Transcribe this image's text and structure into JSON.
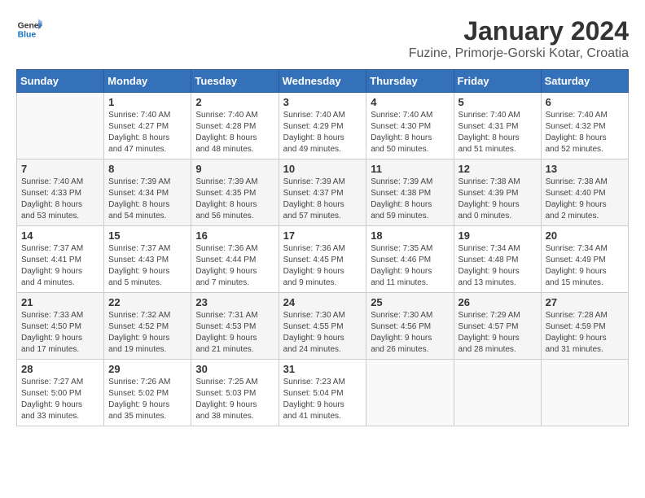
{
  "header": {
    "logo_general": "General",
    "logo_blue": "Blue",
    "title": "January 2024",
    "subtitle": "Fuzine, Primorje-Gorski Kotar, Croatia"
  },
  "calendar": {
    "days_of_week": [
      "Sunday",
      "Monday",
      "Tuesday",
      "Wednesday",
      "Thursday",
      "Friday",
      "Saturday"
    ],
    "weeks": [
      [
        {
          "day": "",
          "info": ""
        },
        {
          "day": "1",
          "info": "Sunrise: 7:40 AM\nSunset: 4:27 PM\nDaylight: 8 hours\nand 47 minutes."
        },
        {
          "day": "2",
          "info": "Sunrise: 7:40 AM\nSunset: 4:28 PM\nDaylight: 8 hours\nand 48 minutes."
        },
        {
          "day": "3",
          "info": "Sunrise: 7:40 AM\nSunset: 4:29 PM\nDaylight: 8 hours\nand 49 minutes."
        },
        {
          "day": "4",
          "info": "Sunrise: 7:40 AM\nSunset: 4:30 PM\nDaylight: 8 hours\nand 50 minutes."
        },
        {
          "day": "5",
          "info": "Sunrise: 7:40 AM\nSunset: 4:31 PM\nDaylight: 8 hours\nand 51 minutes."
        },
        {
          "day": "6",
          "info": "Sunrise: 7:40 AM\nSunset: 4:32 PM\nDaylight: 8 hours\nand 52 minutes."
        }
      ],
      [
        {
          "day": "7",
          "info": "Sunrise: 7:40 AM\nSunset: 4:33 PM\nDaylight: 8 hours\nand 53 minutes."
        },
        {
          "day": "8",
          "info": "Sunrise: 7:39 AM\nSunset: 4:34 PM\nDaylight: 8 hours\nand 54 minutes."
        },
        {
          "day": "9",
          "info": "Sunrise: 7:39 AM\nSunset: 4:35 PM\nDaylight: 8 hours\nand 56 minutes."
        },
        {
          "day": "10",
          "info": "Sunrise: 7:39 AM\nSunset: 4:37 PM\nDaylight: 8 hours\nand 57 minutes."
        },
        {
          "day": "11",
          "info": "Sunrise: 7:39 AM\nSunset: 4:38 PM\nDaylight: 8 hours\nand 59 minutes."
        },
        {
          "day": "12",
          "info": "Sunrise: 7:38 AM\nSunset: 4:39 PM\nDaylight: 9 hours\nand 0 minutes."
        },
        {
          "day": "13",
          "info": "Sunrise: 7:38 AM\nSunset: 4:40 PM\nDaylight: 9 hours\nand 2 minutes."
        }
      ],
      [
        {
          "day": "14",
          "info": "Sunrise: 7:37 AM\nSunset: 4:41 PM\nDaylight: 9 hours\nand 4 minutes."
        },
        {
          "day": "15",
          "info": "Sunrise: 7:37 AM\nSunset: 4:43 PM\nDaylight: 9 hours\nand 5 minutes."
        },
        {
          "day": "16",
          "info": "Sunrise: 7:36 AM\nSunset: 4:44 PM\nDaylight: 9 hours\nand 7 minutes."
        },
        {
          "day": "17",
          "info": "Sunrise: 7:36 AM\nSunset: 4:45 PM\nDaylight: 9 hours\nand 9 minutes."
        },
        {
          "day": "18",
          "info": "Sunrise: 7:35 AM\nSunset: 4:46 PM\nDaylight: 9 hours\nand 11 minutes."
        },
        {
          "day": "19",
          "info": "Sunrise: 7:34 AM\nSunset: 4:48 PM\nDaylight: 9 hours\nand 13 minutes."
        },
        {
          "day": "20",
          "info": "Sunrise: 7:34 AM\nSunset: 4:49 PM\nDaylight: 9 hours\nand 15 minutes."
        }
      ],
      [
        {
          "day": "21",
          "info": "Sunrise: 7:33 AM\nSunset: 4:50 PM\nDaylight: 9 hours\nand 17 minutes."
        },
        {
          "day": "22",
          "info": "Sunrise: 7:32 AM\nSunset: 4:52 PM\nDaylight: 9 hours\nand 19 minutes."
        },
        {
          "day": "23",
          "info": "Sunrise: 7:31 AM\nSunset: 4:53 PM\nDaylight: 9 hours\nand 21 minutes."
        },
        {
          "day": "24",
          "info": "Sunrise: 7:30 AM\nSunset: 4:55 PM\nDaylight: 9 hours\nand 24 minutes."
        },
        {
          "day": "25",
          "info": "Sunrise: 7:30 AM\nSunset: 4:56 PM\nDaylight: 9 hours\nand 26 minutes."
        },
        {
          "day": "26",
          "info": "Sunrise: 7:29 AM\nSunset: 4:57 PM\nDaylight: 9 hours\nand 28 minutes."
        },
        {
          "day": "27",
          "info": "Sunrise: 7:28 AM\nSunset: 4:59 PM\nDaylight: 9 hours\nand 31 minutes."
        }
      ],
      [
        {
          "day": "28",
          "info": "Sunrise: 7:27 AM\nSunset: 5:00 PM\nDaylight: 9 hours\nand 33 minutes."
        },
        {
          "day": "29",
          "info": "Sunrise: 7:26 AM\nSunset: 5:02 PM\nDaylight: 9 hours\nand 35 minutes."
        },
        {
          "day": "30",
          "info": "Sunrise: 7:25 AM\nSunset: 5:03 PM\nDaylight: 9 hours\nand 38 minutes."
        },
        {
          "day": "31",
          "info": "Sunrise: 7:23 AM\nSunset: 5:04 PM\nDaylight: 9 hours\nand 41 minutes."
        },
        {
          "day": "",
          "info": ""
        },
        {
          "day": "",
          "info": ""
        },
        {
          "day": "",
          "info": ""
        }
      ]
    ]
  }
}
